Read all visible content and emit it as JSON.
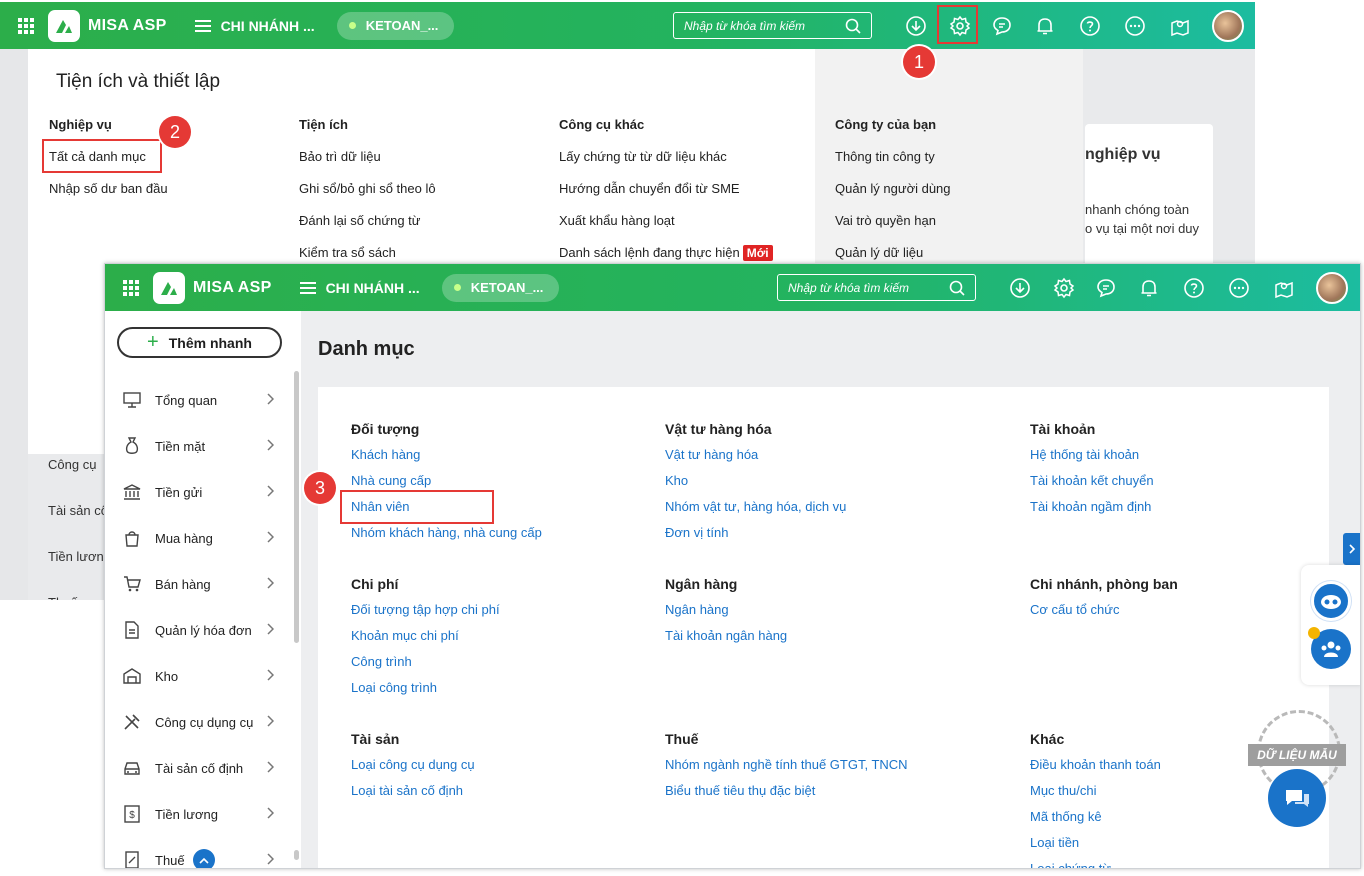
{
  "back": {
    "brand": "MISA ASP",
    "branch": "CHI NHÁNH ...",
    "pill": "KETOAN_...",
    "search_placeholder": "Nhập từ khóa tìm kiếm",
    "panel_title": "Tiện ích và thiết lập",
    "columns": [
      {
        "header": "Nghiệp vụ",
        "items": [
          "Tất cả danh mục",
          "Nhập số dư ban đầu"
        ]
      },
      {
        "header": "Tiện ích",
        "items": [
          "Bảo trì dữ liệu",
          "Ghi sổ/bỏ ghi sổ theo lô",
          "Đánh lại số chứng từ",
          "Kiểm tra sổ sách"
        ]
      },
      {
        "header": "Công cụ khác",
        "items": [
          "Lấy chứng từ từ dữ liệu khác",
          "Hướng dẫn chuyển đổi từ SME",
          "Xuất khẩu hàng loạt",
          "Danh sách lệnh đang thực hiện"
        ]
      },
      {
        "header": "Công ty của bạn",
        "items": [
          "Thông tin công ty",
          "Quản lý người dùng",
          "Vai trò quyền hạn",
          "Quản lý dữ liệu"
        ]
      }
    ],
    "new_badge": "Mới",
    "bg_card_title": "nghiệp vụ",
    "bg_card_text1": "nhanh chóng toàn",
    "bg_card_text2": "o vụ tại một nơi duy",
    "bg_menu": [
      "Công cụ",
      "Tài sản cố",
      "Tiền lươn",
      "Thuế"
    ]
  },
  "front": {
    "brand": "MISA ASP",
    "branch": "CHI NHÁNH ...",
    "pill": "KETOAN_...",
    "search_placeholder": "Nhập từ khóa tìm kiếm",
    "quick_add": "Thêm nhanh",
    "menu": [
      "Tổng quan",
      "Tiền mặt",
      "Tiền gửi",
      "Mua hàng",
      "Bán hàng",
      "Quản lý hóa đơn",
      "Kho",
      "Công cụ dụng cụ",
      "Tài sản cố định",
      "Tiền lương",
      "Thuế"
    ],
    "page_title": "Danh mục",
    "categories": [
      {
        "header": "Đối tượng",
        "links": [
          "Khách hàng",
          "Nhà cung cấp",
          "Nhân viên",
          "Nhóm khách hàng, nhà cung cấp"
        ]
      },
      {
        "header": "Vật tư hàng hóa",
        "links": [
          "Vật tư hàng hóa",
          "Kho",
          "Nhóm vật tư, hàng hóa, dịch vụ",
          "Đơn vị tính"
        ]
      },
      {
        "header": "Tài khoản",
        "links": [
          "Hệ thống tài khoản",
          "Tài khoản kết chuyển",
          "Tài khoản ngầm định"
        ]
      },
      {
        "header": "Chi phí",
        "links": [
          "Đối tượng tập hợp chi phí",
          "Khoản mục chi phí",
          "Công trình",
          "Loại công trình"
        ]
      },
      {
        "header": "Ngân hàng",
        "links": [
          "Ngân hàng",
          "Tài khoản ngân hàng"
        ]
      },
      {
        "header": "Chi nhánh, phòng ban",
        "links": [
          "Cơ cấu tổ chức"
        ]
      },
      {
        "header": "Tài sản",
        "links": [
          "Loại công cụ dụng cụ",
          "Loại tài sản cố định"
        ]
      },
      {
        "header": "Thuế",
        "links": [
          "Nhóm ngành nghề tính thuế GTGT, TNCN",
          "Biểu thuế tiêu thụ đặc biệt"
        ]
      },
      {
        "header": "Khác",
        "links": [
          "Điều khoản thanh toán",
          "Mục thu/chi",
          "Mã thống kê",
          "Loại tiền",
          "Loại chứng từ"
        ]
      }
    ],
    "watermark": "DỮ LIỆU MẪU"
  },
  "steps": [
    "1",
    "2",
    "3"
  ],
  "colors": {
    "green": "#2cae4a",
    "teal": "#1cbca0",
    "link": "#1a73c9",
    "highlight": "#e53935"
  }
}
